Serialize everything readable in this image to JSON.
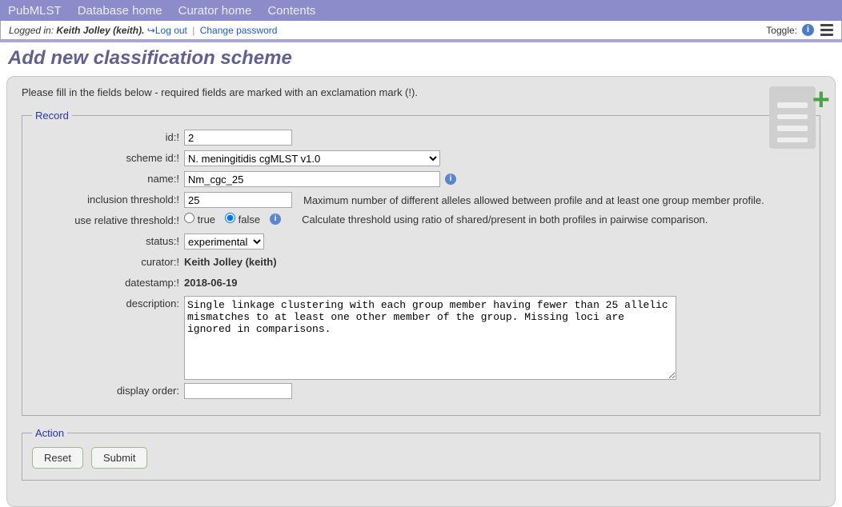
{
  "nav": {
    "items": [
      "PubMLST",
      "Database home",
      "Curator home",
      "Contents"
    ]
  },
  "userbar": {
    "logged_in_label": "Logged in:",
    "user_display": "Keith Jolley (keith).",
    "logout": "Log out",
    "change_password": "Change password",
    "toggle_label": "Toggle:"
  },
  "page_title": "Add new classification scheme",
  "intro": "Please fill in the fields below - required fields are marked with an exclamation mark (!).",
  "record": {
    "legend": "Record",
    "fields": {
      "id": {
        "label": "id:!",
        "value": "2"
      },
      "scheme_id": {
        "label": "scheme id:!",
        "selected": "N. meningitidis cgMLST v1.0"
      },
      "name": {
        "label": "name:!",
        "value": "Nm_cgc_25"
      },
      "inclusion_threshold": {
        "label": "inclusion threshold:!",
        "value": "25",
        "hint": "Maximum number of different alleles allowed between profile and at least one group member profile."
      },
      "use_relative_threshold": {
        "label": "use relative threshold:!",
        "true_label": "true",
        "false_label": "false",
        "hint": "Calculate threshold using ratio of shared/present in both profiles in pairwise comparison."
      },
      "status": {
        "label": "status:!",
        "selected": "experimental"
      },
      "curator": {
        "label": "curator:!",
        "value": "Keith Jolley (keith)"
      },
      "datestamp": {
        "label": "datestamp:!",
        "value": "2018-06-19"
      },
      "description": {
        "label": "description:",
        "value": "Single linkage clustering with each group member having fewer than 25 allelic mismatches to at least one other member of the group. Missing loci are ignored in comparisons."
      },
      "display_order": {
        "label": "display order:",
        "value": ""
      }
    }
  },
  "action": {
    "legend": "Action",
    "reset": "Reset",
    "submit": "Submit"
  }
}
